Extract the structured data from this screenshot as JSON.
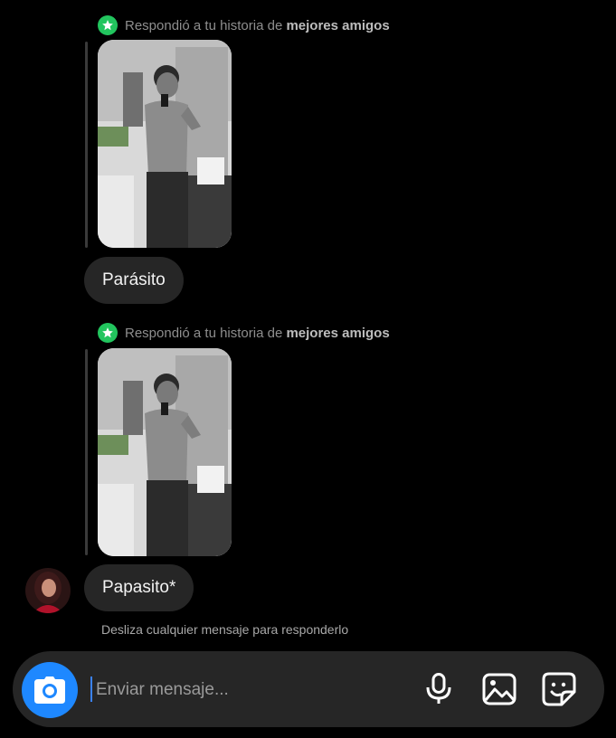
{
  "thread": {
    "reply_prefix": "Respondió a tu historia de ",
    "reply_story_type": "mejores amigos",
    "messages": [
      {
        "text": "Parásito"
      },
      {
        "text": "Papasito*"
      }
    ],
    "swipe_hint": "Desliza cualquier mensaje para responderlo"
  },
  "composer": {
    "placeholder": "Enviar mensaje...",
    "icons": [
      "camera-icon",
      "microphone-icon",
      "gallery-icon",
      "sticker-icon"
    ]
  },
  "colors": {
    "background": "#000000",
    "bubble": "#262626",
    "accent_blue": "#1e88ff",
    "best_friends_green": "#22c55e"
  }
}
